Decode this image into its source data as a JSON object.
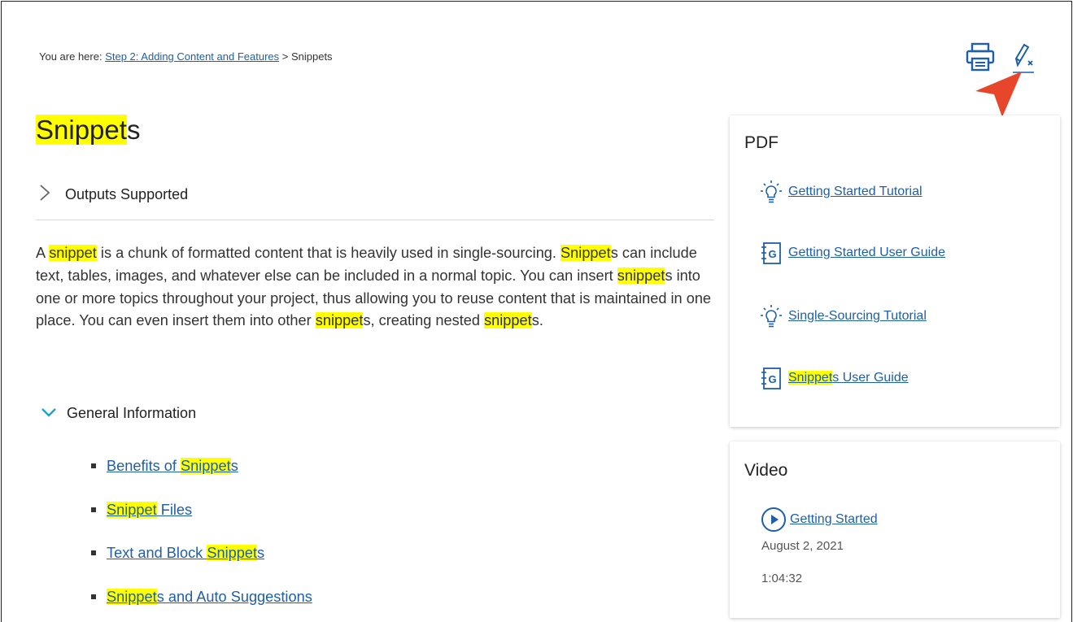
{
  "breadcrumb": {
    "prefix": "You are here: ",
    "link": "Step 2: Adding Content and Features",
    "separator": " > ",
    "current": "Snippets"
  },
  "toolbar": {
    "print_icon": "printer-icon",
    "clear_highlight_icon": "pencil-clear-icon"
  },
  "page": {
    "title_highlight": "Snippet",
    "title_rest": "s"
  },
  "outputs_dropdown": {
    "label": "Outputs Supported",
    "icon": "chevron-right-icon"
  },
  "intro": {
    "t1": "A ",
    "h1": "snippet",
    "t2": " is a chunk of formatted content that is heavily used in single-sourcing. ",
    "h2": "Snippet",
    "t3": "s can include text, tables, images, and whatever else can be included in a normal topic. You can insert ",
    "h3": "snippet",
    "t4": "s into one or more topics throughout your project, thus allowing you to reuse content that is maintained in one place. You can even insert them into other ",
    "h4": "snippet",
    "t5": "s, creating nested ",
    "h5": "snippet",
    "t6": "s."
  },
  "general_dropdown": {
    "label": "General Information",
    "icon": "chevron-down-icon"
  },
  "general_links": [
    {
      "before": "Benefits of ",
      "hl": "Snippet",
      "after": "s"
    },
    {
      "before": "",
      "hl": "Snippet",
      "after": " Files"
    },
    {
      "before": "Text and Block ",
      "hl": "Snippet",
      "after": "s"
    },
    {
      "before": "",
      "hl": "Snippet",
      "after": "s and Auto Suggestions"
    }
  ],
  "pdf": {
    "heading": "PDF",
    "items": [
      {
        "icon": "lightbulb-icon",
        "before": "",
        "hl": "",
        "after": "Getting Started Tutorial"
      },
      {
        "icon": "guide-book-icon",
        "before": "",
        "hl": "",
        "after": "Getting Started User Guide"
      },
      {
        "icon": "lightbulb-icon",
        "before": "",
        "hl": "",
        "after": "Single-Sourcing Tutorial"
      },
      {
        "icon": "guide-book-icon",
        "before": "",
        "hl": "Snippet",
        "after": "s User Guide"
      }
    ]
  },
  "video": {
    "heading": "Video",
    "title": "Getting Started",
    "date": "August 2, 2021",
    "duration": "1:04:32",
    "icon": "play-circle-icon"
  },
  "colors": {
    "highlight": "#ffff00",
    "link": "#1f5fa8",
    "accent_chevron": "#1aa3c6",
    "pointer": "#e8462a"
  }
}
